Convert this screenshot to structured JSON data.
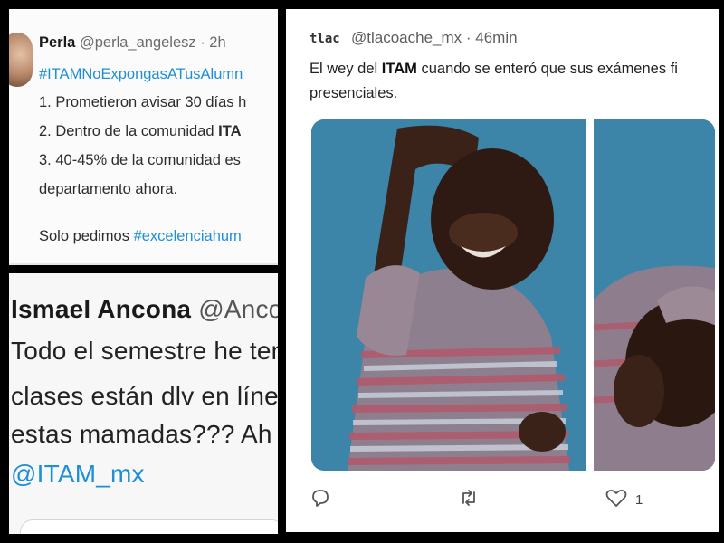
{
  "tweet_perla": {
    "name": "Perla",
    "meta": "@perla_angelesz · 2h",
    "hashtag": "#ITAMNoExpongasATusAlumn",
    "line1": "1. Prometieron avisar 30 días h",
    "line2_pre": "2.  Dentro de la comunidad ",
    "line2_bold": "ITA",
    "line3": "3. 40-45% de la comunidad es",
    "line4": "departamento ahora.",
    "line5_pre": "Solo pedimos ",
    "line5_tag": "#excelenciahum"
  },
  "tweet_ismael": {
    "name": "Ismael Ancona",
    "handle": "@Anco",
    "line1": "Todo el semestre he ten",
    "line2": "clases están dlv en línea",
    "line3": "estas mamadas??? Ah y",
    "mention": "@ITAM_mx"
  },
  "tweet_tlacoache": {
    "avatar_text": "tlac",
    "meta": "@tlacoache_mx · 46min",
    "line1_pre": "El wey del ",
    "line1_bold": "ITAM",
    "line1_post": " cuando se enteró que sus exámenes fi",
    "line2": "presenciales.",
    "like_count": "1",
    "images": [
      "crying-boy-photo-left",
      "crying-boy-photo-right"
    ]
  },
  "colors": {
    "link": "#1d8fd6",
    "background": "#000000",
    "photo_wall": "#3b83a6"
  }
}
